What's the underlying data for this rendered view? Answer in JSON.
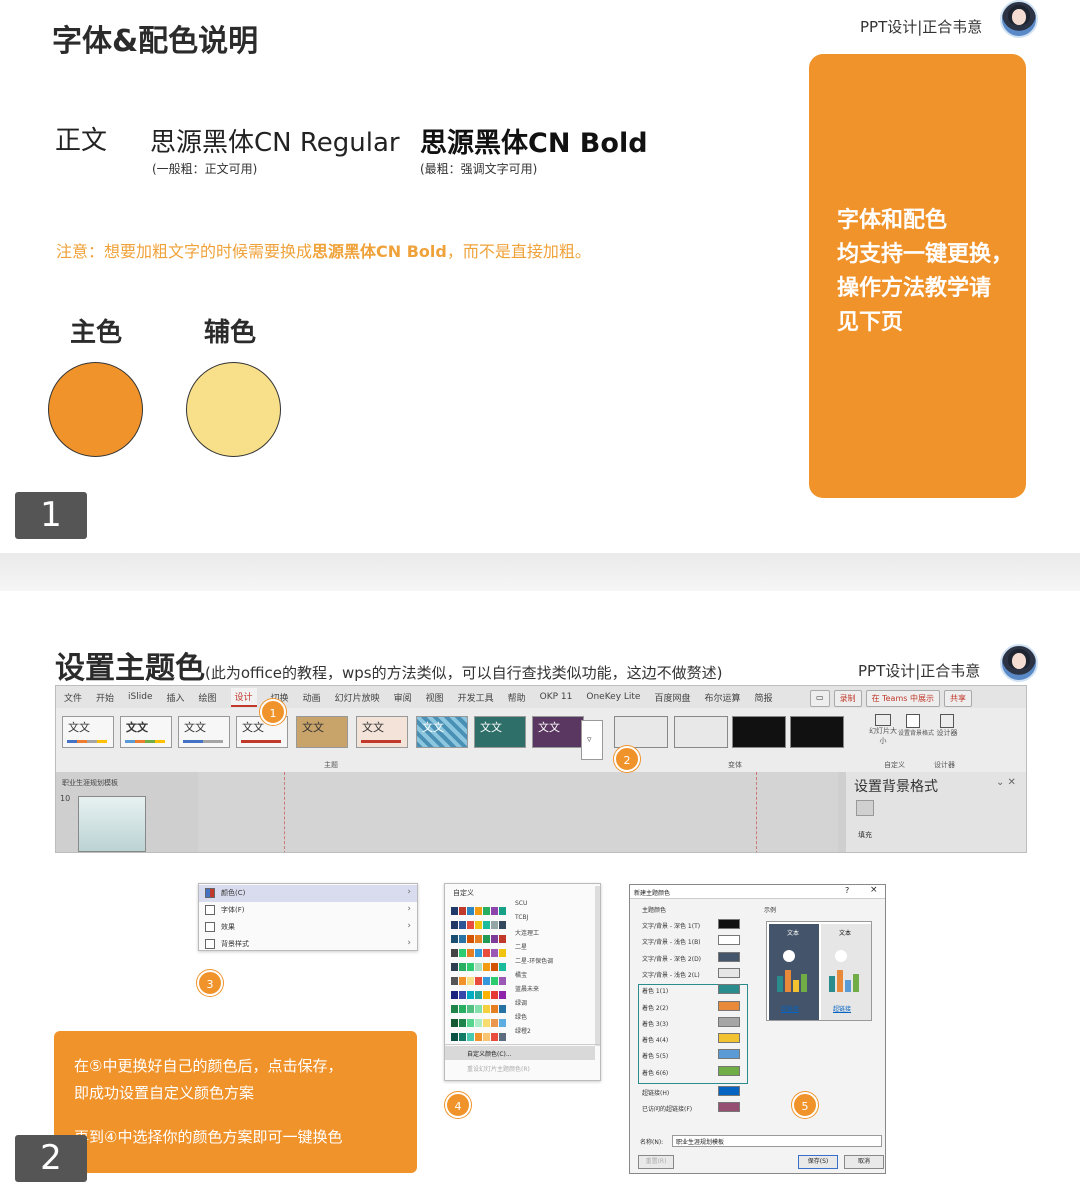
{
  "slide1": {
    "title": "字体&配色说明",
    "brand": "PPT设计|正合韦意",
    "body_label": "正文",
    "font_regular": "思源黑体CN Regular",
    "font_regular_note": "(一般粗：正文可用)",
    "font_bold": "思源黑体CN Bold",
    "font_bold_note": "(最粗：强调文字可用)",
    "notice_pre": "注意：想要加粗文字的时候需要换成",
    "notice_bold": "思源黑体CN Bold",
    "notice_post": "，而不是直接加粗。",
    "primary_label": "主色",
    "secondary_label": "辅色",
    "primary_color": "#f0932b",
    "secondary_color": "#f8df8a",
    "card_text": "字体和配色\n均支持一键更换，\n操作方法教学请\n见下页",
    "page_number": "1"
  },
  "slide2": {
    "title": "设置主题色",
    "subtitle": "(此为office的教程，wps的方法类似，可以自行查找类似功能，这边不做赘述)",
    "brand": "PPT设计|正合韦意",
    "menu": [
      "文件",
      "开始",
      "iSlide",
      "插入",
      "绘图",
      "设计",
      "切换",
      "动画",
      "幻灯片放映",
      "审阅",
      "视图",
      "开发工具",
      "帮助",
      "OKP 11",
      "OneKey Lite",
      "百度网盘",
      "布尔运算",
      "简报"
    ],
    "menu_active": "设计",
    "ribbon_buttons": [
      "录制",
      "在 Teams 中展示",
      "共享"
    ],
    "theme_text": "文文",
    "group_theme": "主题",
    "group_variant": "变体",
    "group_custom": "自定义",
    "group_designer": "设计器",
    "slide_size": "幻灯片大小",
    "bg_format": "设置背景格式",
    "designer": "设计器",
    "pane_title": "设置背景格式",
    "pane_fill": "填充",
    "thumb_title": "职业生涯规划模板",
    "slide_num": "10",
    "steps": [
      "1",
      "2",
      "3",
      "4",
      "5"
    ],
    "popup3": [
      {
        "label": "颜色(C)"
      },
      {
        "label": "字体(F)"
      },
      {
        "label": "效果"
      },
      {
        "label": "背景样式"
      }
    ],
    "popup4": {
      "header": "自定义",
      "schemes": [
        "SCU",
        "TCBJ",
        "大连理工",
        "二星",
        "二星-环保色调",
        "橘宝",
        "蓝晨未来",
        "绿调",
        "绿色",
        "绿橙2"
      ],
      "custom": "自定义颜色(C)...",
      "reset": "重设幻灯片主题颜色(R)"
    },
    "dialog5": {
      "title": "新建主题颜色",
      "section": "主题颜色",
      "sample_label": "示例",
      "sample_text": "文本",
      "link_text": "超链接",
      "rows": [
        {
          "label": "文字/背景 - 深色 1(T)",
          "color": "#111111"
        },
        {
          "label": "文字/背景 - 浅色 1(B)",
          "color": "#ffffff"
        },
        {
          "label": "文字/背景 - 深色 2(D)",
          "color": "#44546a"
        },
        {
          "label": "文字/背景 - 浅色 2(L)",
          "color": "#e7e6e6"
        },
        {
          "label": "着色 1(1)",
          "color": "#2a8c8c"
        },
        {
          "label": "着色 2(2)",
          "color": "#e88a3a"
        },
        {
          "label": "着色 3(3)",
          "color": "#a5a5a5"
        },
        {
          "label": "着色 4(4)",
          "color": "#f2c230"
        },
        {
          "label": "着色 5(5)",
          "color": "#5b9bd5"
        },
        {
          "label": "着色 6(6)",
          "color": "#70ad47"
        },
        {
          "label": "超链接(H)",
          "color": "#0563c1"
        },
        {
          "label": "已访问的超链接(F)",
          "color": "#954f72"
        }
      ],
      "name_label": "名称(N):",
      "name_value": "职业生涯规划模板",
      "reset_btn": "重置(R)",
      "save_btn": "保存(S)",
      "cancel_btn": "取消",
      "help": "?",
      "close": "×"
    },
    "note_line1": "在⑤中更换好自己的颜色后，点击保存，",
    "note_line2": "即成功设置自定义颜色方案",
    "note_line3": "再到④中选择你的颜色方案即可一键换色",
    "page_number": "2"
  }
}
